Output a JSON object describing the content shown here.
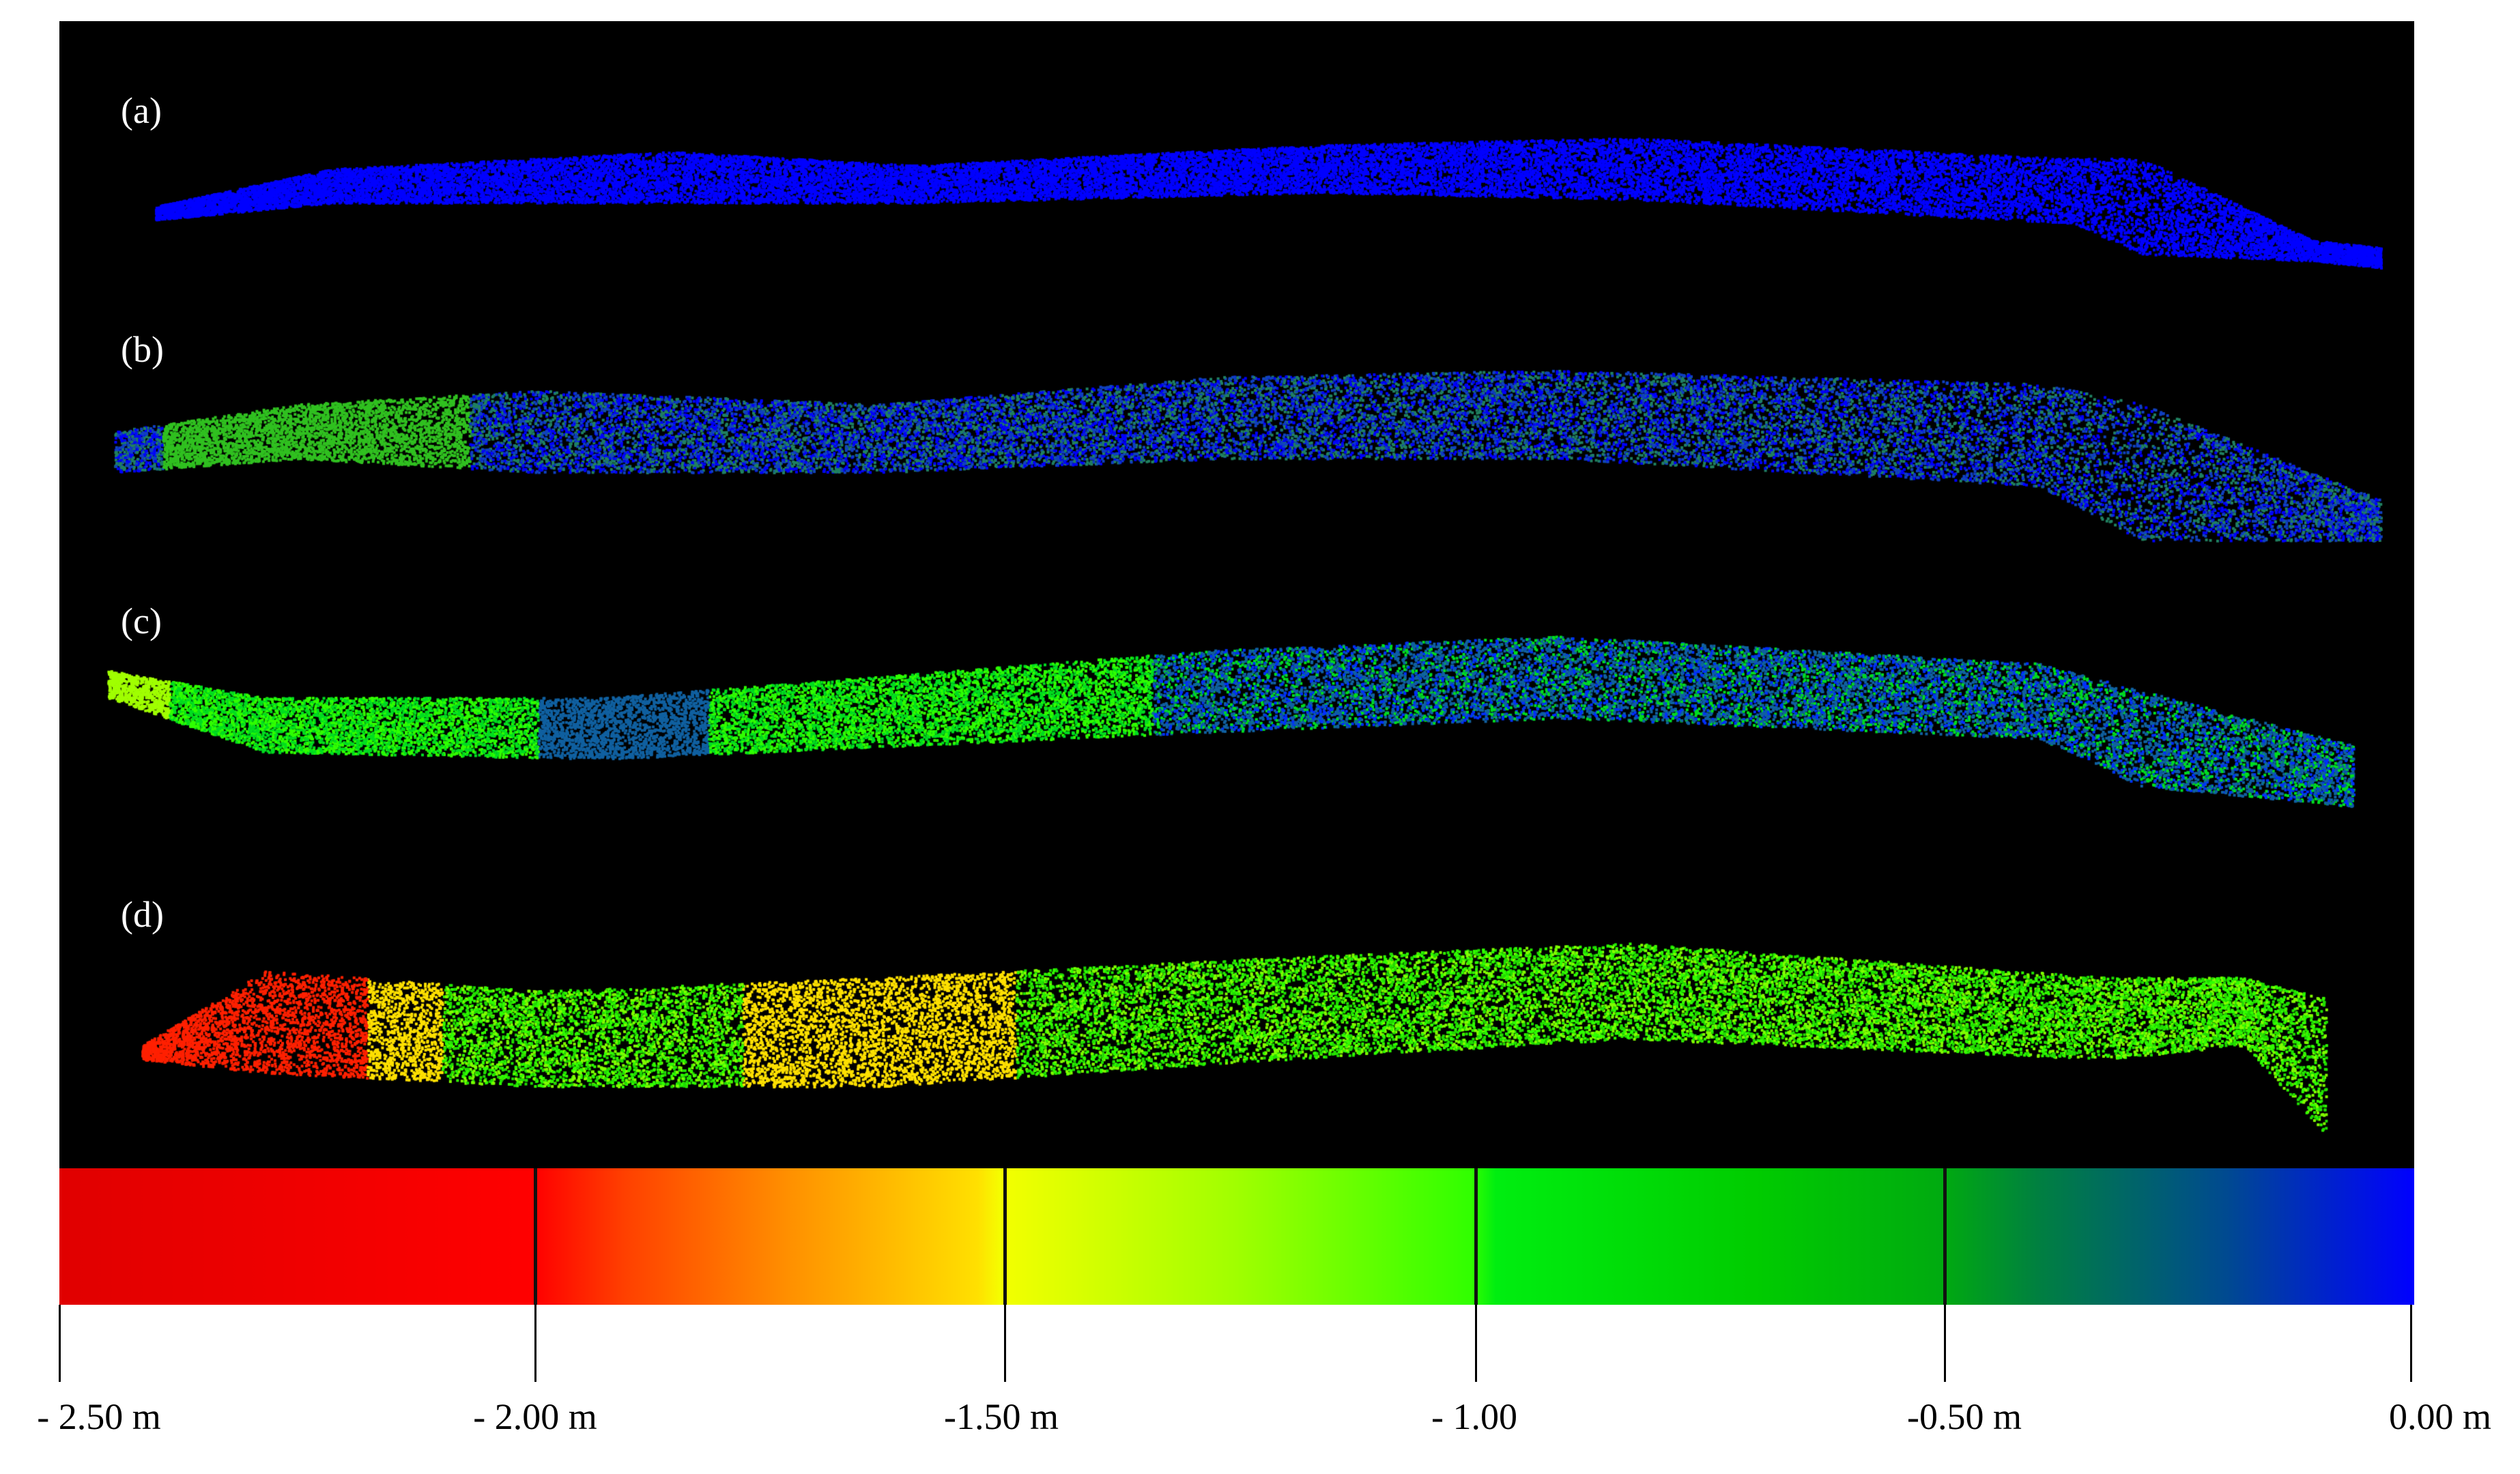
{
  "panels": [
    {
      "label": "(a)",
      "colors": [
        "#0000ff"
      ]
    },
    {
      "label": "(b)",
      "colors": [
        "#0000ff",
        "#1040c0",
        "#208060",
        "#30c020"
      ]
    },
    {
      "label": "(c)",
      "colors": [
        "#30ff00",
        "#00dd20",
        "#1060a0",
        "#0030ff",
        "#a0ff00"
      ]
    },
    {
      "label": "(d)",
      "colors": [
        "#30ff00",
        "#20dd00",
        "#80ff00",
        "#ffe000",
        "#ff2000"
      ]
    }
  ],
  "colorbar": {
    "ticks": [
      "- 2.50 m",
      "- 2.00 m",
      "-1.50 m",
      "- 1.00",
      "-0.50 m",
      "0.00 m"
    ],
    "values": [
      -2.5,
      -2.0,
      -1.5,
      -1.0,
      -0.5,
      0.0
    ]
  }
}
